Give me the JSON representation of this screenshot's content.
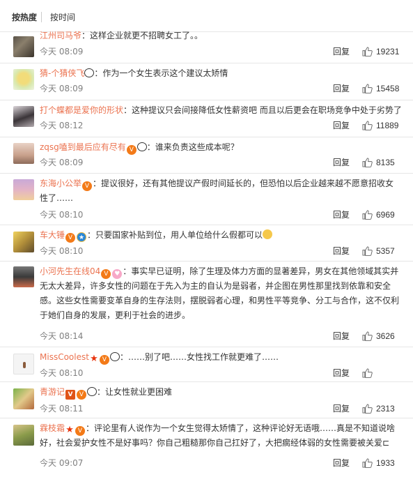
{
  "sort": {
    "hot": "按热度",
    "time": "按时间"
  },
  "reply_label": "回复",
  "comments": [
    {
      "user": "江州司马爷",
      "text": "：这样企业就更不招聘女工了。。",
      "time": "今天 08:09",
      "likes": "19231"
    },
    {
      "user": "猜-个猜侠飞",
      "text": "：作为一个女生表示这个建议太矫情",
      "time": "今天 08:09",
      "likes": "15458"
    },
    {
      "user": "打个蝶都是爱你的形状",
      "text": "：这种提议只会间接降低女性薪资吧 而且以后更会在职场竞争中处于劣势了",
      "time": "今天 08:12",
      "likes": "11889"
    },
    {
      "user": "zqsg嗑到最后应有尽有",
      "text": "：谁来负责这些成本呢？",
      "time": "今天 08:09",
      "likes": "8135"
    },
    {
      "user": "东海小公举",
      "text": "：提议很好，还有其他提议产假时间延长的，但恐怕以后企业越来越不愿意招收女性了……",
      "time": "今天 08:10",
      "likes": "6969"
    },
    {
      "user": "车大锤",
      "text": "：只要国家补贴到位，用人单位给什么假都可以",
      "time": "今天 08:10",
      "likes": "5357"
    },
    {
      "user": "小河先生在线04",
      "text": "：事实早已证明，除了生理及体力方面的显著差异，男女在其他领域其实并无太大差异，许多女性的问题在于先入为主的自认为是弱者，并企图在男性那里找到依靠和安全感。这些女性需要变革自身的生存法则，摆脱弱者心理，和男性平等竞争、分工与合作，这不仅利于她们自身的发展，更利于社会的进步。",
      "time": "今天 08:14",
      "likes": "3626"
    },
    {
      "user": "MissCoolest",
      "text": "：……别了吧……女性找工作就更难了……",
      "time": "今天 08:10",
      "likes": ""
    },
    {
      "user": "青游记",
      "text": "：让女性就业更困难",
      "time": "今天 08:11",
      "likes": "2313"
    },
    {
      "user": "霖枝霜",
      "text": "：评论里有人说作为一个女生觉得太矫情了，这种评论好无语哦……真是不知道说啥好，社会爱护女性不是好事吗？你自己粗糙那你自己扛好了，大把瘸经体弱的女性需要被关爱⊏",
      "time": "今天 09:07",
      "likes": "1933"
    }
  ],
  "colors": {
    "username": "#eb7350",
    "meta": "#808080",
    "text": "#333333",
    "divider": "#e6e6e6"
  }
}
